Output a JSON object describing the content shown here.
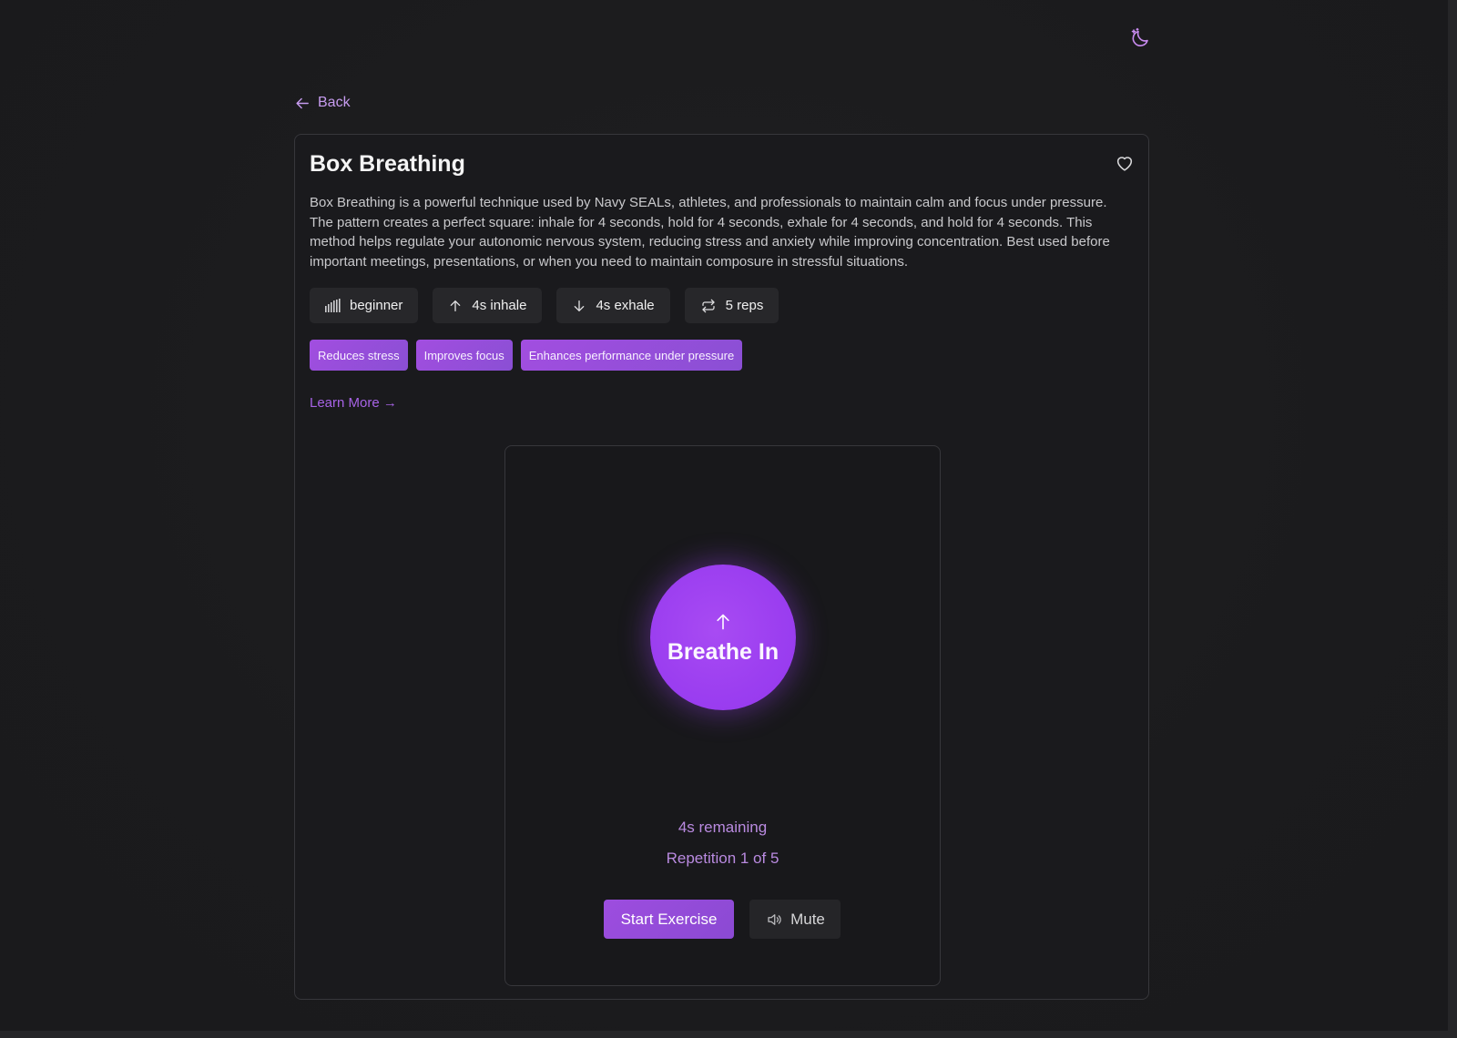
{
  "header": {
    "theme_toggle_icon": "moon-stars-icon"
  },
  "nav": {
    "back_label": "Back",
    "back_icon": "arrow-left-icon"
  },
  "exercise": {
    "title": "Box Breathing",
    "favorite_icon": "heart-icon",
    "description": "Box Breathing is a powerful technique used by Navy SEALs, athletes, and professionals to maintain calm and focus under pressure. The pattern creates a perfect square: inhale for 4 seconds, hold for 4 seconds, exhale for 4 seconds, and hold for 4 seconds. This method helps regulate your autonomic nervous system, reducing stress and anxiety while improving concentration. Best used before important meetings, presentations, or when you need to maintain composure in stressful situations.",
    "stats": [
      {
        "icon": "signal-bars-icon",
        "label": "beginner"
      },
      {
        "icon": "arrow-up-icon",
        "label": "4s inhale"
      },
      {
        "icon": "arrow-down-icon",
        "label": "4s exhale"
      },
      {
        "icon": "repeat-icon",
        "label": "5 reps"
      }
    ],
    "benefits": [
      "Reduces stress",
      "Improves focus",
      "Enhances performance under pressure"
    ],
    "learn_more_label": "Learn More →"
  },
  "player": {
    "phase_icon": "arrow-up-icon",
    "phase_label": "Breathe In",
    "remaining_text": "4s remaining",
    "repetition_text": "Repetition 1 of 5",
    "start_label": "Start Exercise",
    "mute_label": "Mute",
    "mute_icon": "speaker-icon"
  },
  "colors": {
    "accent": "#9b3ef0",
    "accent_text": "#c79cf0",
    "background": "#1c1c1e",
    "card": "#1a1a1d"
  }
}
